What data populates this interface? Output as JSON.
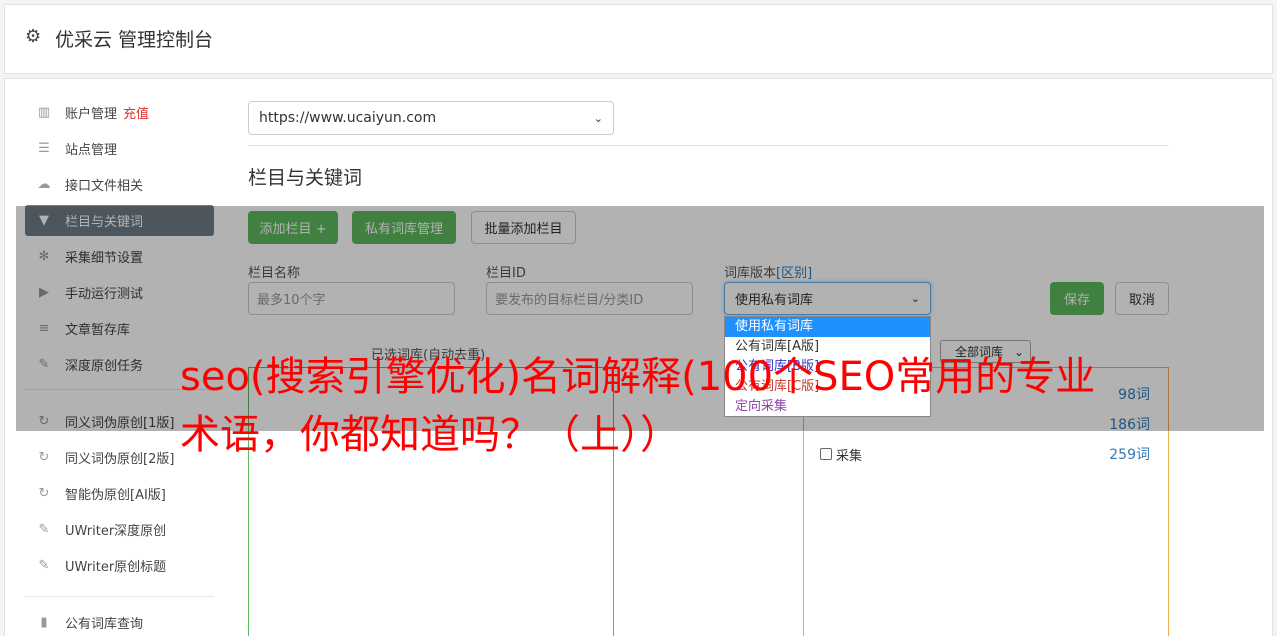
{
  "header": {
    "title": "优采云 管理控制台",
    "icon": "gear-icon"
  },
  "sidebar": {
    "items": [
      {
        "label": "账户管理",
        "badge": "充值",
        "icon": "bar-chart-icon"
      },
      {
        "label": "站点管理",
        "icon": "server-icon"
      },
      {
        "label": "接口文件相关",
        "icon": "cloud-upload-icon"
      },
      {
        "label": "栏目与关键词",
        "icon": "filter-icon",
        "active": true
      },
      {
        "label": "采集细节设置",
        "icon": "gears-icon"
      },
      {
        "label": "手动运行测试",
        "icon": "play-circle-icon"
      },
      {
        "label": "文章暂存库",
        "icon": "database-icon"
      },
      {
        "label": "深度原创任务",
        "icon": "edit-icon"
      },
      {
        "label": "同义词伪原创[1版]",
        "icon": "refresh-icon"
      },
      {
        "label": "同义词伪原创[2版]",
        "icon": "refresh-icon"
      },
      {
        "label": "智能伪原创[AI版]",
        "icon": "refresh-icon"
      },
      {
        "label": "UWriter深度原创",
        "icon": "edit-icon"
      },
      {
        "label": "UWriter原创标题",
        "icon": "edit-icon"
      },
      {
        "label": "公有词库查询",
        "icon": "book-icon"
      }
    ]
  },
  "main": {
    "site_select": "https://www.ucaiyun.com",
    "section_title": "栏目与关键词",
    "buttons": {
      "add_column": "添加栏目 +",
      "private_lib": "私有词库管理",
      "batch_add": "批量添加栏目",
      "save": "保存",
      "cancel": "取消"
    },
    "form": {
      "column_name_label": "栏目名称",
      "column_name_placeholder": "最多10个字",
      "column_id_label": "栏目ID",
      "column_id_placeholder": "要发布的目标栏目/分类ID",
      "version_label": "词库版本",
      "version_link": "[区别]",
      "version_value": "使用私有词库",
      "version_options": [
        "使用私有词库",
        "公有词库[A版]",
        "公有词库[B版]",
        "公有词库[C版]",
        "定向采集"
      ],
      "option_colors": [
        "#ffffff",
        "#333333",
        "#3333cc",
        "#c0392b",
        "#8e44ad"
      ]
    },
    "selected_words_label": "已选词库(自动去重)",
    "all_libs_select": "全部词库",
    "lib_rows": [
      {
        "name": "",
        "count": "98词"
      },
      {
        "name": "",
        "count": "186词"
      },
      {
        "name": "采集",
        "count": "259词"
      }
    ]
  },
  "headline": "seo(搜索引擎优化)名词解释(100个SEO常用的专业术语，你都知道吗？（上））"
}
